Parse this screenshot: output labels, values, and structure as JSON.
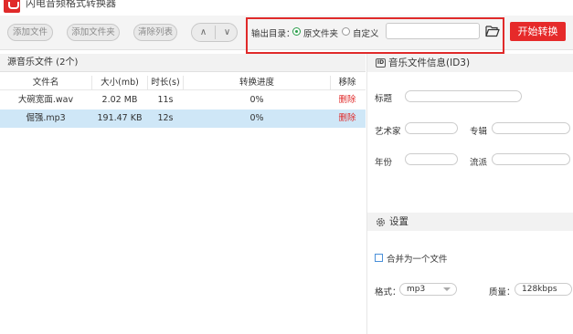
{
  "app": {
    "title": "闪电音频格式转换器"
  },
  "toolbar": {
    "add_file": "添加文件",
    "add_folder": "添加文件夹",
    "clear_list": "清除列表",
    "up": "∧",
    "down": "∨"
  },
  "output": {
    "label": "输出目录：",
    "option_original": "原文件夹",
    "option_custom": "自定义",
    "selected": "原文件夹",
    "path_value": "",
    "start_button": "开始转换"
  },
  "file_list": {
    "title": "源音乐文件 (2个)",
    "columns": [
      "文件名",
      "大小(mb)",
      "时长(s)",
      "转换进度",
      "移除"
    ],
    "rows": [
      {
        "name": "大碗宽面.wav",
        "size": "2.02 MB",
        "duration": "11s",
        "progress": "0%",
        "remove": "删除",
        "selected": false
      },
      {
        "name": "倔强.mp3",
        "size": "191.47 KB",
        "duration": "12s",
        "progress": "0%",
        "remove": "删除",
        "selected": true
      }
    ]
  },
  "id3": {
    "title": "音乐文件信息(ID3)",
    "icon_text": "ID",
    "fields": {
      "title": "标题",
      "artist": "艺术家",
      "album": "专辑",
      "year": "年份",
      "genre": "流派"
    }
  },
  "settings": {
    "title": "设置",
    "merge_label": "合并为一个文件",
    "merge_checked": false,
    "format_label": "格式：",
    "format_value": "mp3",
    "quality_label": "质量：",
    "quality_value": "128kbps"
  },
  "colors": {
    "accent": "#e62a2a",
    "selected_row": "#cfe7f7",
    "radio_on": "#2a9d4a"
  }
}
